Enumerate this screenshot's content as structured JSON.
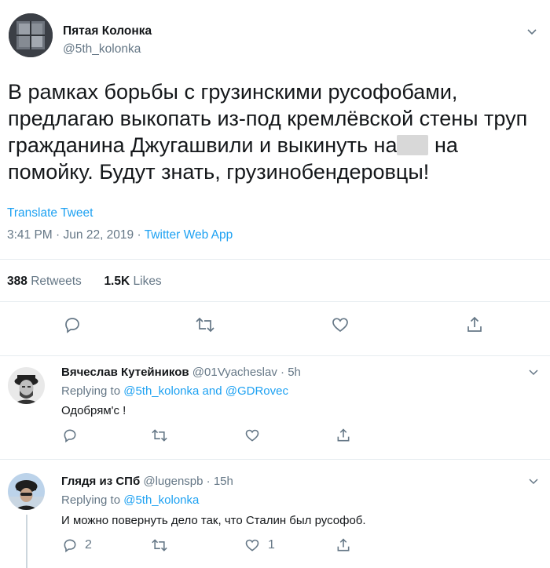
{
  "tweet": {
    "author_name": "Пятая Колонка",
    "author_handle": "@5th_kolonka",
    "text_part1": "В рамках борьбы с грузинскими русофобами, предлагаю выкопать из-под кремлёвской стены труп гражданина Джугашвили и выкинуть на",
    "text_part2": " на помойку. Будут знать, грузинобендеровцы!",
    "translate_label": "Translate Tweet",
    "time": "3:41 PM",
    "date": "Jun 22, 2019",
    "separator": "·",
    "source": "Twitter Web App",
    "retweets_count": "388",
    "retweets_label": "Retweets",
    "likes_count": "1.5K",
    "likes_label": "Likes"
  },
  "replies": [
    {
      "author_name": "Вячеслав Кутейников",
      "author_handle": "@01Vyacheslav",
      "time": "5h",
      "replying_prefix": "Replying to",
      "replying_to_1": "@5th_kolonka",
      "replying_and": "and",
      "replying_to_2": "@GDRovec",
      "text": "Одобрям'с !",
      "reply_count": "",
      "like_count": ""
    },
    {
      "author_name": "Глядя из СПб",
      "author_handle": "@lugenspb",
      "time": "15h",
      "replying_prefix": "Replying to",
      "replying_to_1": "@5th_kolonka",
      "text": "И можно повернуть дело так, что Сталин был русофоб.",
      "reply_count": "2",
      "like_count": "1"
    }
  ],
  "icons": {
    "reply": "reply-icon",
    "retweet": "retweet-icon",
    "like": "heart-icon",
    "share": "share-icon",
    "caret": "chevron-down-icon"
  },
  "colors": {
    "link": "#1da1f2",
    "secondary_text": "#657786",
    "primary_text": "#14171a",
    "divider": "#e6ecf0"
  }
}
